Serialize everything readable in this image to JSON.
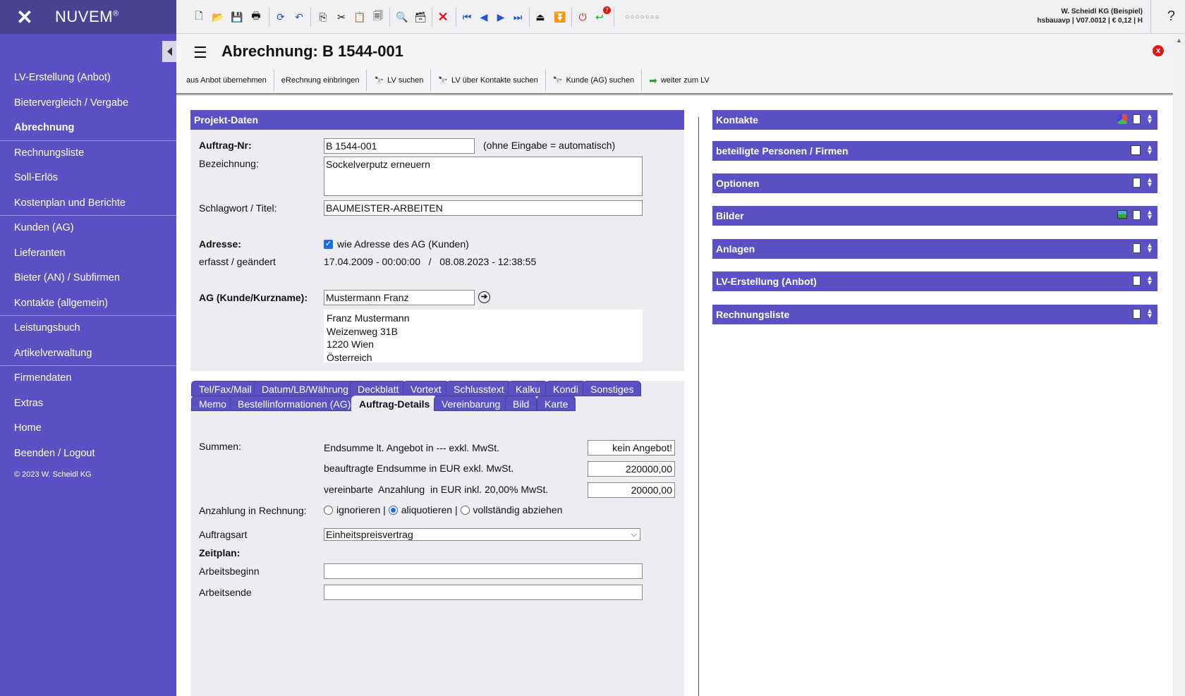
{
  "app": {
    "brand": "NUVEM",
    "brand_mark": "®",
    "copyright": "© 2023 W. Scheidl KG"
  },
  "user": {
    "line1": "W. Scheidl KG (Beispiel)",
    "line2": "hsbauavp | V07.0012 | € 0,12 | H"
  },
  "toolbar": {
    "help_label": "?",
    "notification_count": "7"
  },
  "sidebar": {
    "items": [
      {
        "label": "LV-Erstellung (Anbot)"
      },
      {
        "label": "Bietervergleich / Vergabe"
      },
      {
        "label": "Abrechnung"
      },
      {
        "label": "Rechnungsliste"
      },
      {
        "label": "Soll-Erlös"
      },
      {
        "label": "Kostenplan und Berichte"
      },
      {
        "label": "Kunden (AG)"
      },
      {
        "label": "Lieferanten"
      },
      {
        "label": "Bieter (AN) / Subfirmen"
      },
      {
        "label": "Kontakte (allgemein)"
      },
      {
        "label": "Leistungsbuch"
      },
      {
        "label": "Artikelverwaltung"
      },
      {
        "label": "Firmendaten"
      },
      {
        "label": "Extras"
      },
      {
        "label": "Home"
      },
      {
        "label": "Beenden / Logout"
      }
    ]
  },
  "page": {
    "title": "Abrechnung: B 1544-001",
    "close_label": "x"
  },
  "actions": [
    {
      "label": "aus Anbot übernehmen"
    },
    {
      "label": "eRechnung einbringen"
    },
    {
      "label": "LV suchen"
    },
    {
      "label": "LV über Kontakte suchen"
    },
    {
      "label": "Kunde (AG) suchen"
    },
    {
      "label": "weiter zum LV"
    }
  ],
  "projekt": {
    "header": "Projekt-Daten",
    "auftrag_label": "Auftrag-Nr:",
    "auftrag_value": "B 1544-001",
    "auftrag_hint": "(ohne Eingabe = automatisch)",
    "bezeichnung_label": "Bezeichnung:",
    "bezeichnung_value": "Sockelverputz erneuern",
    "schlagwort_label": "Schlagwort / Titel:",
    "schlagwort_value": "BAUMEISTER-ARBEITEN",
    "adresse_label": "Adresse:",
    "adresse_check": "wie Adresse des AG (Kunden)",
    "erfasst_label": "erfasst / geändert",
    "erfasst_value": "17.04.2009 - 00:00:00   /   08.08.2023 - 12:38:55",
    "ag_label": "AG (Kunde/Kurzname):",
    "ag_value": "Mustermann Franz",
    "address_lines": [
      "Franz Mustermann",
      "Weizenweg 31B",
      "1220 Wien",
      "Österreich"
    ]
  },
  "tabs_row1": [
    "Tel/Fax/Mail",
    "Datum/LB/Währung",
    "Deckblatt",
    "Vortext",
    "Schlusstext",
    "Kalku",
    "Kondi",
    "Sonstiges"
  ],
  "tabs_row2": [
    "Memo",
    "Bestellinformationen (AG)",
    "Auftrag-Details",
    "Vereinbarung",
    "Bild",
    "Karte"
  ],
  "details": {
    "summen_label": "Summen:",
    "endsumme_angebot_label": "Endsumme lt. Angebot in --- exkl. MwSt.",
    "endsumme_angebot_value": "kein Angebot!",
    "beauftragt_label": "beauftragte Endsumme in EUR exkl. MwSt.",
    "beauftragt_value": "220000,00",
    "anzahlung_label": "vereinbarte  Anzahlung  in EUR inkl. 20,00% MwSt.",
    "anzahlung_value": "20000,00",
    "anzahlung_rechnung_label": "Anzahlung in Rechnung:",
    "radio_options": [
      "ignorieren",
      "aliquotieren",
      "vollständig abziehen"
    ],
    "radio_sep": "|",
    "auftragsart_label": "Auftragsart",
    "auftragsart_value": "Einheitspreisvertrag",
    "zeitplan_label": "Zeitplan:",
    "arbeitsbeginn_label": "Arbeitsbeginn",
    "arbeitsbeginn_value": "",
    "arbeitsende_label": "Arbeitsende",
    "arbeitsende_value": ""
  },
  "right_sections": [
    {
      "label": "Kontakte"
    },
    {
      "label": "beteiligte Personen / Firmen"
    },
    {
      "label": "Optionen"
    },
    {
      "label": "Bilder"
    },
    {
      "label": "Anlagen"
    },
    {
      "label": "LV-Erstellung (Anbot)"
    },
    {
      "label": "Rechnungsliste"
    }
  ],
  "colors": {
    "sidebar": "#5a52c4",
    "accent_blue": "#1a6ee6",
    "close_red": "#e01818"
  }
}
